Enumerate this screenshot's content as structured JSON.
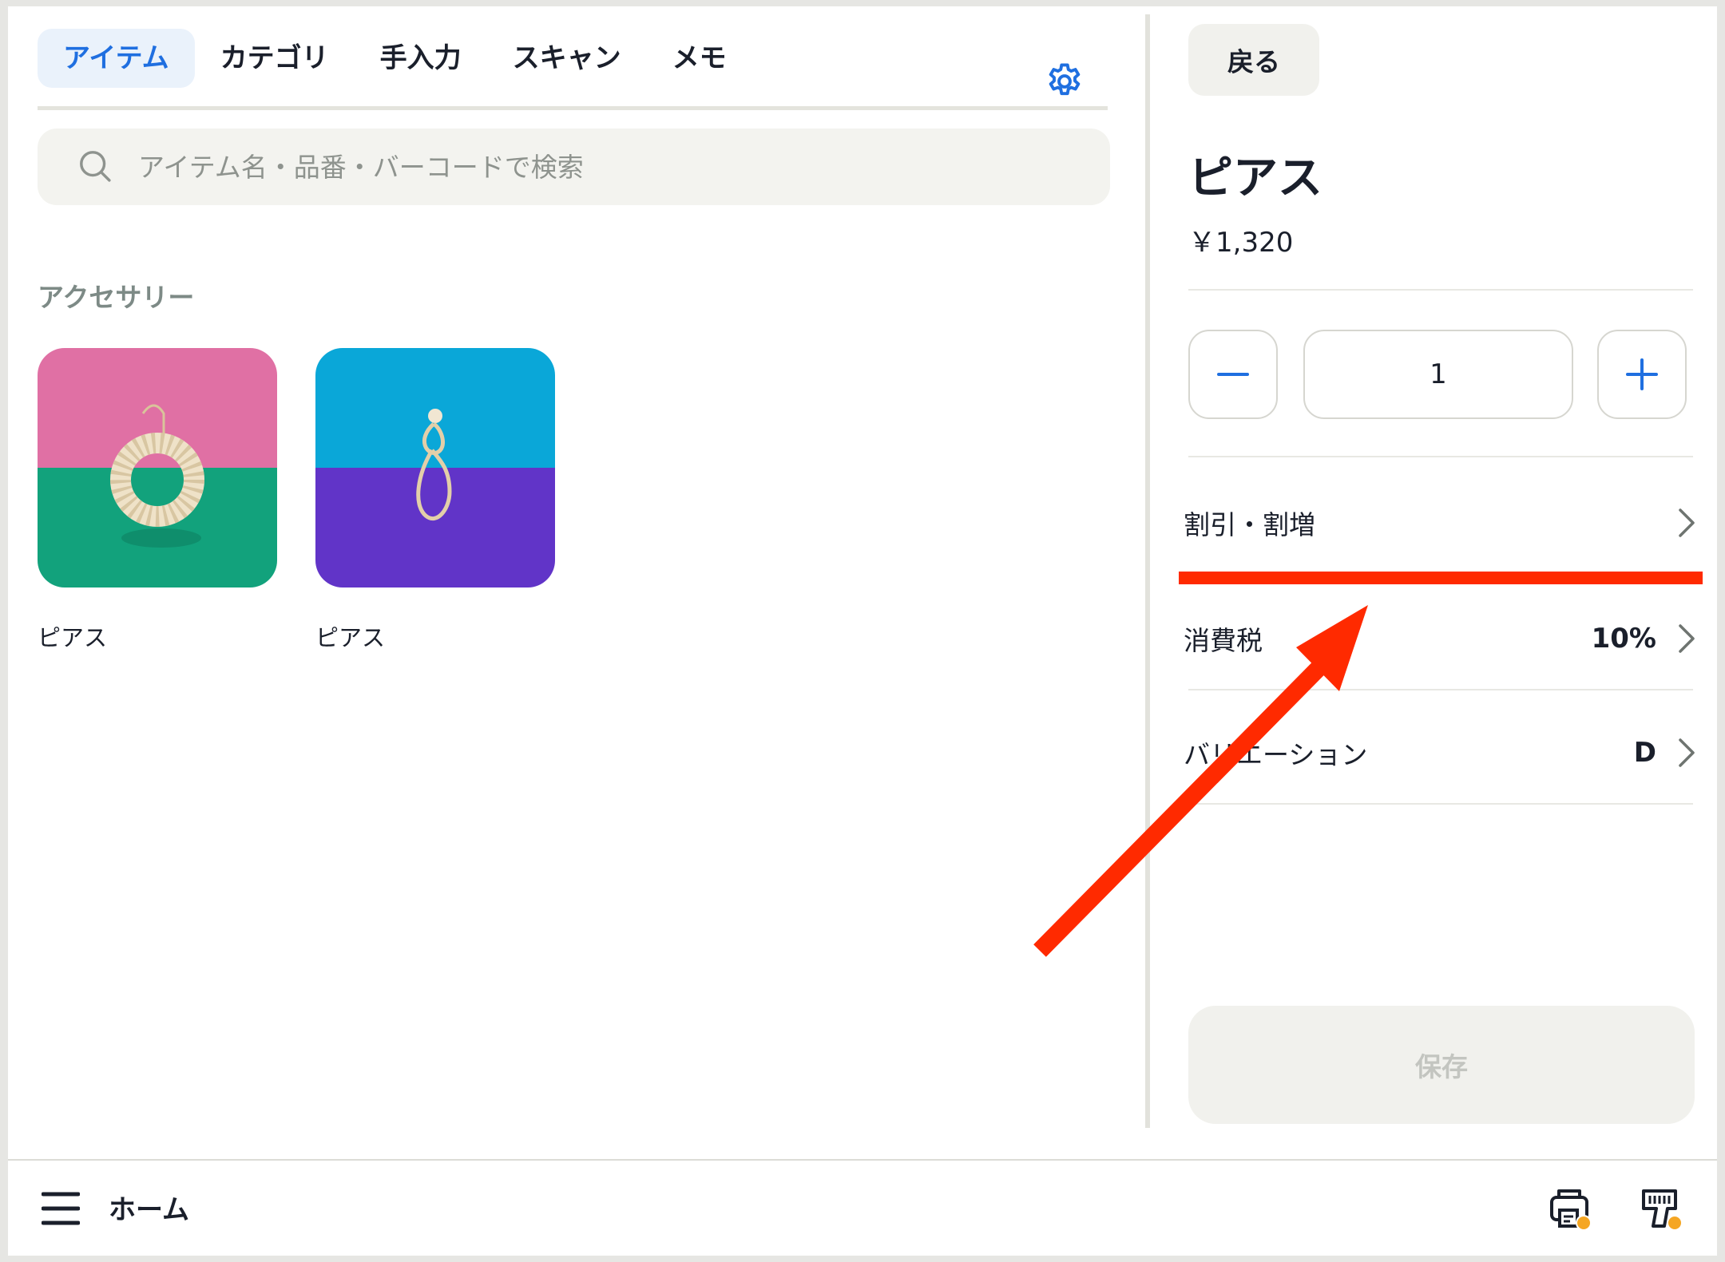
{
  "tabs": [
    {
      "label": "アイテム",
      "active": true
    },
    {
      "label": "カテゴリ",
      "active": false
    },
    {
      "label": "手入力",
      "active": false
    },
    {
      "label": "スキャン",
      "active": false
    },
    {
      "label": "メモ",
      "active": false
    }
  ],
  "search": {
    "placeholder": "アイテム名・品番・バーコードで検索"
  },
  "category": {
    "title": "アクセサリー",
    "items": [
      {
        "name": "ピアス",
        "colors": [
          "#e070a4",
          "#12a27c"
        ]
      },
      {
        "name": "ピアス",
        "colors": [
          "#0aa7d8",
          "#6134c8"
        ]
      }
    ]
  },
  "detail": {
    "back_label": "戻る",
    "title": "ピアス",
    "price": "￥1,320",
    "quantity": "1",
    "rows": [
      {
        "label": "割引・割増",
        "value": ""
      },
      {
        "label": "消費税",
        "value": "10%"
      },
      {
        "label": "バリエーション",
        "value": "D"
      }
    ],
    "save_label": "保存"
  },
  "bottom": {
    "home_label": "ホーム"
  },
  "colors": {
    "accent": "#1f6fe0",
    "annotation": "#ff2a00",
    "badge": "#f5a623"
  }
}
